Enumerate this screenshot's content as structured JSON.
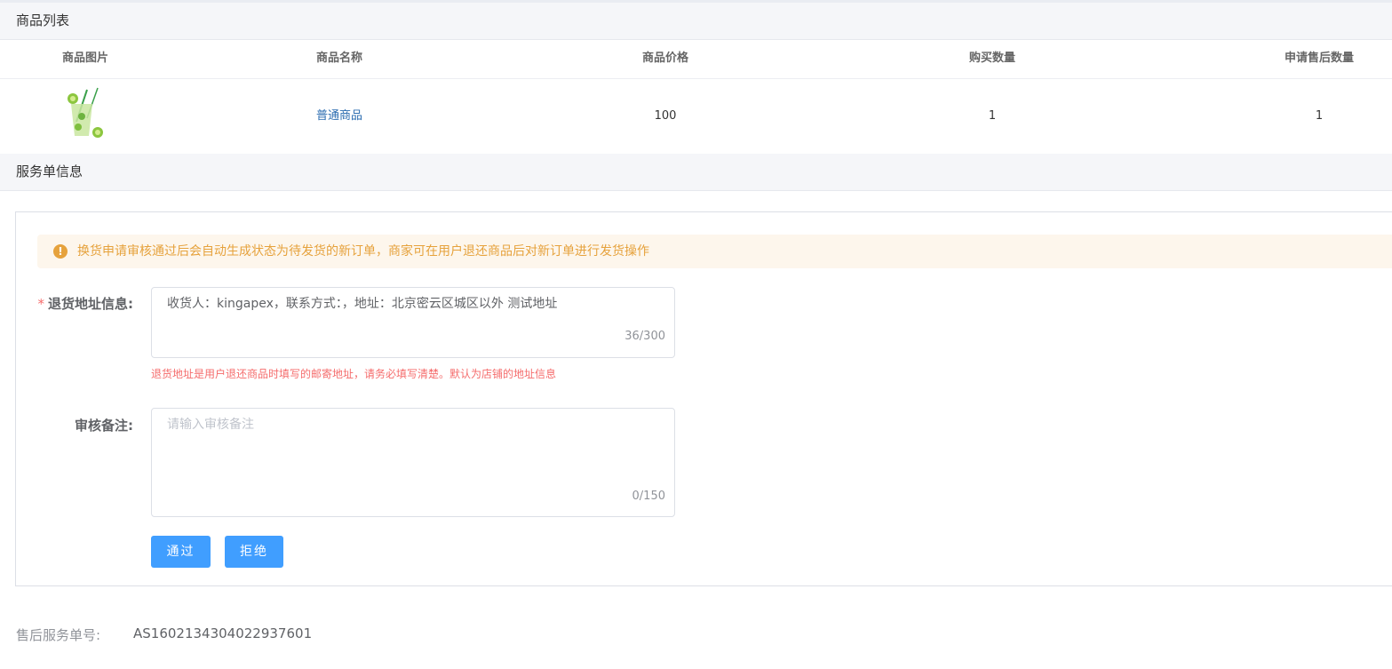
{
  "product_section": {
    "title": "商品列表",
    "columns": [
      "商品图片",
      "商品名称",
      "商品价格",
      "购买数量",
      "申请售后数量"
    ],
    "rows": [
      {
        "name": "普通商品",
        "price": "100",
        "quantity": "1",
        "after_sale_quantity": "1"
      }
    ]
  },
  "service_section": {
    "title": "服务单信息",
    "alert": "换货申请审核通过后会自动生成状态为待发货的新订单，商家可在用户退还商品后对新订单进行发货操作",
    "return_address": {
      "label": "退货地址信息:",
      "required_mark": "*",
      "value": "收货人：kingapex，联系方式：，地址：北京密云区城区以外 测试地址",
      "counter": "36/300",
      "hint": "退货地址是用户退还商品时填写的邮寄地址，请务必填写清楚。默认为店铺的地址信息"
    },
    "review_note": {
      "label": "审核备注:",
      "placeholder": "请输入审核备注",
      "counter": "0/150"
    },
    "buttons": {
      "approve": "通过",
      "reject": "拒绝"
    }
  },
  "service_number": {
    "label": "售后服务单号:",
    "value": "AS1602134304022937601"
  },
  "colors": {
    "primary": "#409eff",
    "warning": "#e6a23c",
    "danger": "#f56c6c",
    "link": "#2b6cb0"
  }
}
